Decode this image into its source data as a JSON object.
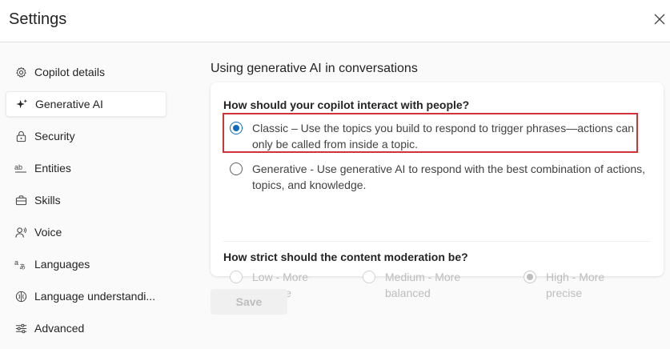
{
  "header": {
    "title": "Settings",
    "close_icon": "close-icon"
  },
  "sidebar": {
    "items": [
      {
        "label": "Copilot details",
        "icon": "gear-icon",
        "active": false
      },
      {
        "label": "Generative AI",
        "icon": "sparkle-icon",
        "active": true
      },
      {
        "label": "Security",
        "icon": "lock-icon",
        "active": false
      },
      {
        "label": "Entities",
        "icon": "entities-icon",
        "active": false
      },
      {
        "label": "Skills",
        "icon": "briefcase-icon",
        "active": false
      },
      {
        "label": "Voice",
        "icon": "voice-icon",
        "active": false
      },
      {
        "label": "Languages",
        "icon": "language-icon",
        "active": false
      },
      {
        "label": "Language understandi...",
        "icon": "brain-icon",
        "active": false
      },
      {
        "label": "Advanced",
        "icon": "sliders-icon",
        "active": false
      }
    ]
  },
  "main": {
    "section_title": "Using generative AI in conversations",
    "interaction": {
      "question": "How should your copilot interact with people?",
      "options": [
        {
          "label": "Classic – Use the topics you build to respond to trigger phrases—actions can only be called from inside a topic.",
          "selected": true
        },
        {
          "label": "Generative - Use generative AI to respond with the best combination of actions, topics, and knowledge.",
          "selected": false
        }
      ]
    },
    "moderation": {
      "question": "How strict should the content moderation be?",
      "options": [
        {
          "label": "Low - More creative",
          "selected": false,
          "disabled": true
        },
        {
          "label": "Medium - More balanced",
          "selected": false,
          "disabled": true
        },
        {
          "label": "High - More precise",
          "selected": true,
          "disabled": true
        }
      ]
    },
    "save_label": "Save"
  },
  "colors": {
    "accent": "#0f6cbd",
    "highlight": "#d13438"
  }
}
